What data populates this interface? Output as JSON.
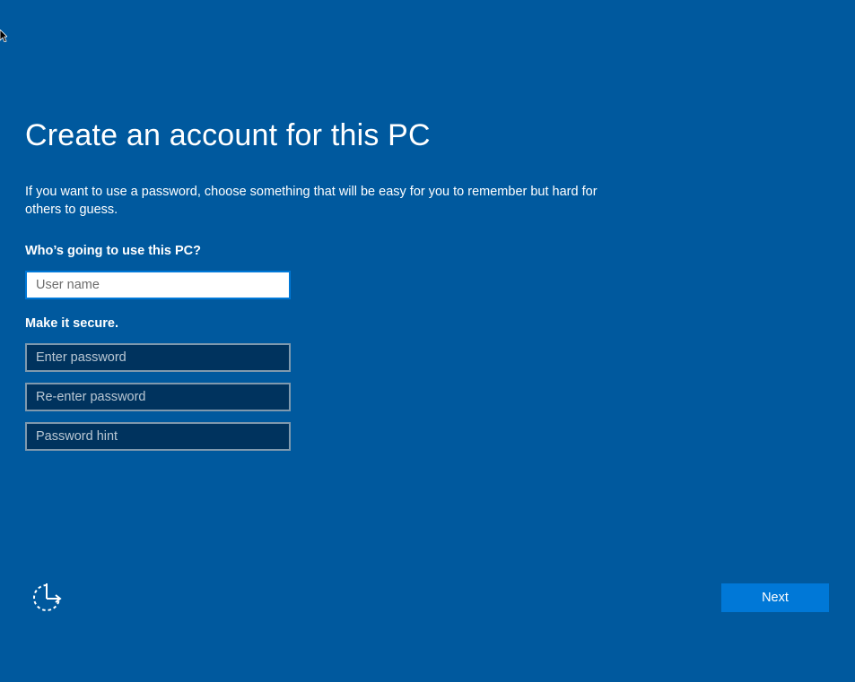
{
  "header": {
    "title": "Create an account for this PC",
    "description": "If you want to use a password, choose something that will be easy for you to remember but hard for others to guess."
  },
  "user_section": {
    "label": "Who’s going to use this PC?",
    "username_placeholder": "User name",
    "username_value": ""
  },
  "security_section": {
    "label": "Make it secure.",
    "password_placeholder": "Enter password",
    "reenter_placeholder": "Re-enter password",
    "hint_placeholder": "Password hint"
  },
  "footer": {
    "ease_of_access_icon": "ease-of-access-icon",
    "next_label": "Next"
  },
  "colors": {
    "background": "#00599e",
    "accent": "#0078d7",
    "field_dark": "#00335e"
  }
}
